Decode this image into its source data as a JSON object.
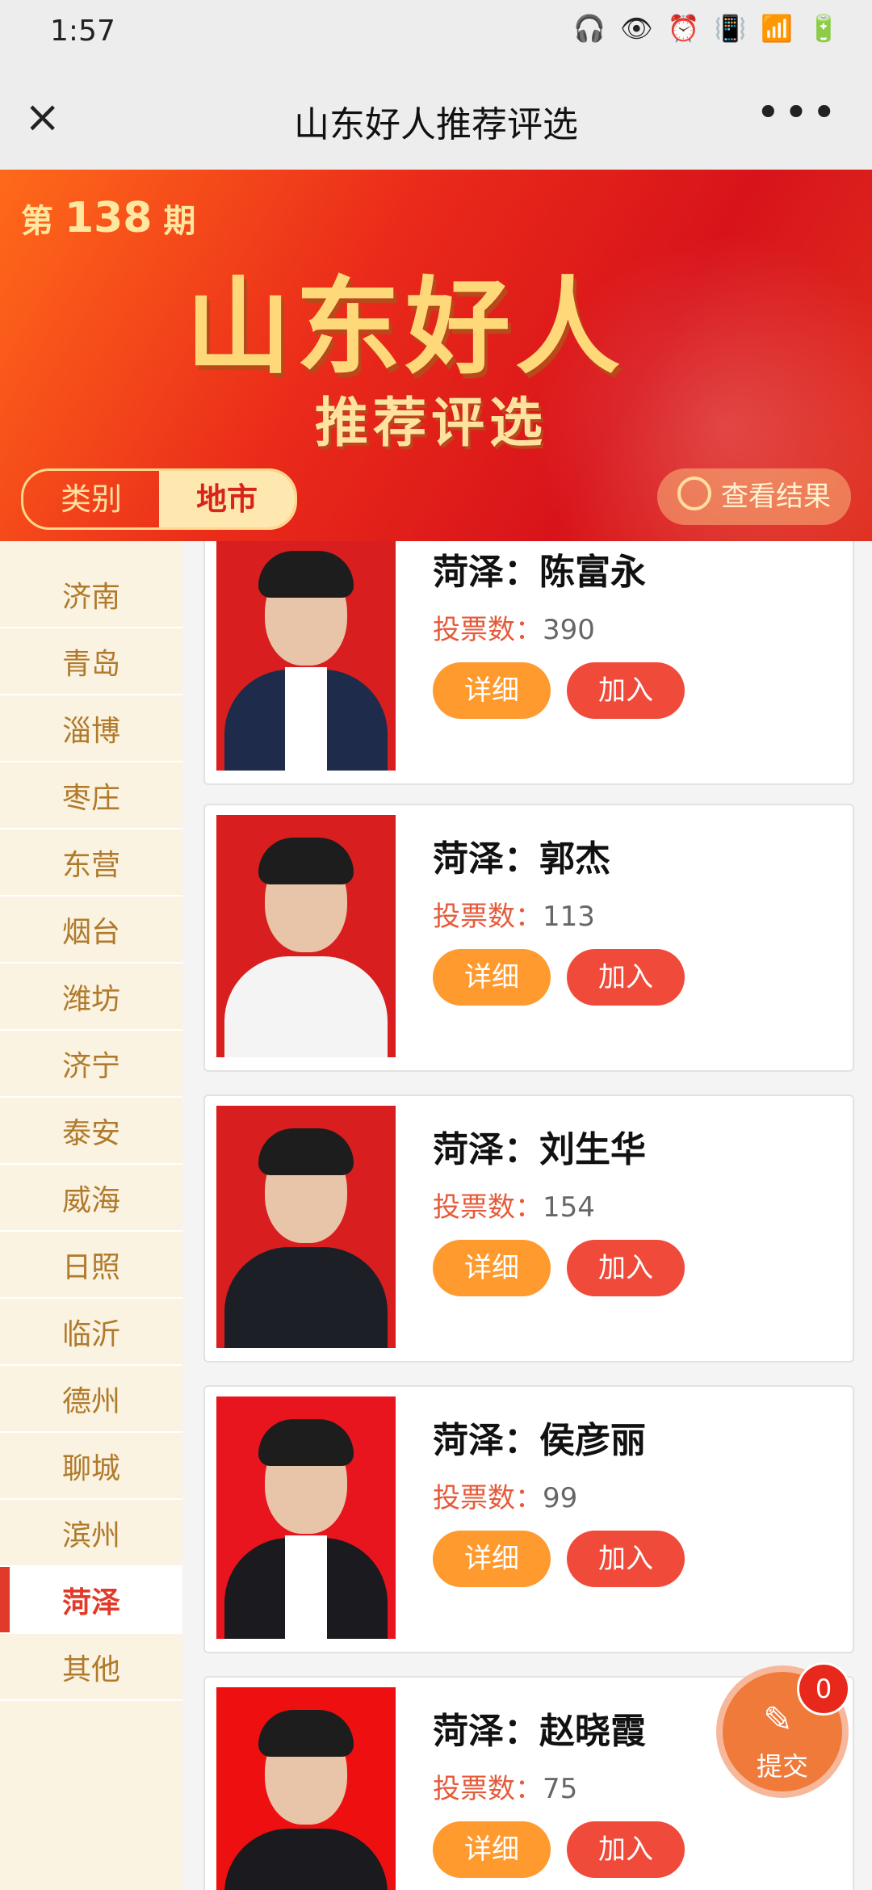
{
  "status": {
    "time": "1:57",
    "icons": [
      "headphones-icon",
      "eye-icon",
      "alarm-icon",
      "vibrate-icon",
      "wifi-icon",
      "5g-signal-icon",
      "battery-icon"
    ]
  },
  "titlebar": {
    "title": "山东好人推荐评选",
    "close_label": "×",
    "more_label": "•••"
  },
  "banner": {
    "issue_prefix": "第",
    "issue_number": "138",
    "issue_suffix": "期",
    "main_title": "山东好人",
    "sub_title": "推荐评选",
    "tabs": [
      {
        "label": "类别",
        "active": false
      },
      {
        "label": "地市",
        "active": true
      }
    ],
    "view_result": "查看结果"
  },
  "sidebar": {
    "items": [
      {
        "label": "济南",
        "active": false
      },
      {
        "label": "青岛",
        "active": false
      },
      {
        "label": "淄博",
        "active": false
      },
      {
        "label": "枣庄",
        "active": false
      },
      {
        "label": "东营",
        "active": false
      },
      {
        "label": "烟台",
        "active": false
      },
      {
        "label": "潍坊",
        "active": false
      },
      {
        "label": "济宁",
        "active": false
      },
      {
        "label": "泰安",
        "active": false
      },
      {
        "label": "威海",
        "active": false
      },
      {
        "label": "日照",
        "active": false
      },
      {
        "label": "临沂",
        "active": false
      },
      {
        "label": "德州",
        "active": false
      },
      {
        "label": "聊城",
        "active": false
      },
      {
        "label": "滨州",
        "active": false
      },
      {
        "label": "菏泽",
        "active": true
      },
      {
        "label": "其他",
        "active": false
      }
    ]
  },
  "candidates": [
    {
      "name": "菏泽：陈富永",
      "votes_label": "投票数：",
      "votes": "390",
      "detail": "详细",
      "join": "加入",
      "photo_bg": "#d81e1e",
      "suit": "#1f2b4a"
    },
    {
      "name": "菏泽：郭杰",
      "votes_label": "投票数：",
      "votes": "113",
      "detail": "详细",
      "join": "加入",
      "photo_bg": "#d81e1e",
      "suit": "#f4f4f4"
    },
    {
      "name": "菏泽：刘生华",
      "votes_label": "投票数：",
      "votes": "154",
      "detail": "详细",
      "join": "加入",
      "photo_bg": "#d81e1e",
      "suit": "#1c1f26"
    },
    {
      "name": "菏泽：侯彦丽",
      "votes_label": "投票数：",
      "votes": "99",
      "detail": "详细",
      "join": "加入",
      "photo_bg": "#e8141e",
      "suit": "#1a1a1f"
    },
    {
      "name": "菏泽：赵晓霞",
      "votes_label": "投票数：",
      "votes": "75",
      "detail": "详细",
      "join": "加入",
      "photo_bg": "#ee1010",
      "suit": "#1a1a1f"
    }
  ],
  "submit": {
    "label": "提交",
    "badge": "0"
  },
  "colors": {
    "accent_red": "#e23a2a",
    "detail_orange": "#ff9a2e",
    "join_red": "#f04a3a",
    "sidebar_bg": "#fbf3e1"
  }
}
